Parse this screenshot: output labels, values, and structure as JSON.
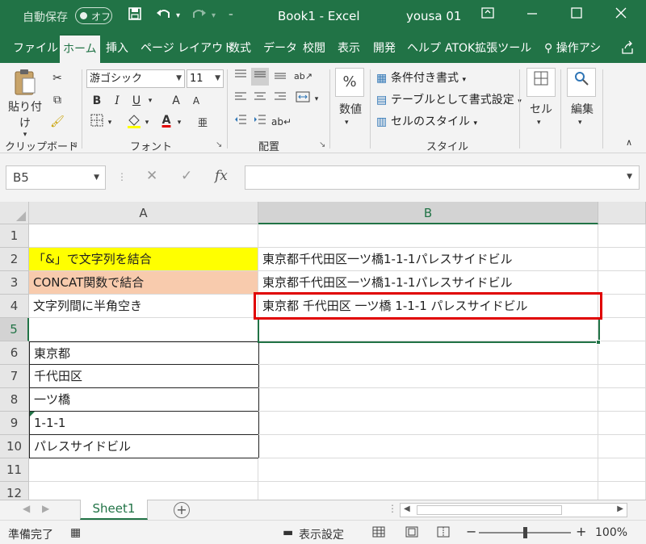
{
  "titlebar": {
    "autosave_label": "自動保存",
    "autosave_state": "オフ",
    "save_icon": "save-icon",
    "undo_icon": "undo-icon",
    "redo_icon": "redo-icon",
    "customize_icon": "customize-qat-icon",
    "doc_title": "Book1  -  Excel",
    "user": "yousa 01"
  },
  "tabs": [
    {
      "label": "ファイル"
    },
    {
      "label": "ホーム"
    },
    {
      "label": "挿入"
    },
    {
      "label": "ページ レイアウト"
    },
    {
      "label": "数式"
    },
    {
      "label": "データ"
    },
    {
      "label": "校閲"
    },
    {
      "label": "表示"
    },
    {
      "label": "開発"
    },
    {
      "label": "ヘルプ"
    },
    {
      "label": "ATOK拡張ツール"
    },
    {
      "label": "操作アシ"
    }
  ],
  "ribbon": {
    "clipboard": {
      "paste": "貼り付け",
      "label": "クリップボード"
    },
    "font": {
      "name": "游ゴシック",
      "size": "11",
      "bold": "B",
      "italic": "I",
      "underline": "U",
      "grow": "A",
      "shrink": "A",
      "font_color_letter": "A",
      "label": "フォント"
    },
    "alignment": {
      "label": "配置"
    },
    "number": {
      "pct": "%",
      "label_btn": "数値"
    },
    "styles": {
      "conditional": "条件付き書式",
      "as_table": "テーブルとして書式設定",
      "cell_styles": "セルのスタイル",
      "label": "スタイル"
    },
    "cells": {
      "label": "セル"
    },
    "editing": {
      "label": "編集"
    }
  },
  "formula_bar": {
    "name_box": "B5",
    "cancel": "✕",
    "enter": "✓",
    "fx": "fx",
    "value": ""
  },
  "columns": [
    {
      "label": "A"
    },
    {
      "label": "B"
    }
  ],
  "rows": [
    {
      "num": "1",
      "a": "",
      "b": ""
    },
    {
      "num": "2",
      "a": "「&」で文字列を結合",
      "b": "東京都千代田区一ツ橋1-1-1パレスサイドビル"
    },
    {
      "num": "3",
      "a": "CONCAT関数で結合",
      "b": "東京都千代田区一ツ橋1-1-1パレスサイドビル"
    },
    {
      "num": "4",
      "a": "文字列間に半角空き",
      "b": "東京都 千代田区 一ツ橋 1-1-1 パレスサイドビル"
    },
    {
      "num": "5",
      "a": "",
      "b": ""
    },
    {
      "num": "6",
      "a": "東京都",
      "b": ""
    },
    {
      "num": "7",
      "a": "千代田区",
      "b": ""
    },
    {
      "num": "8",
      "a": "一ツ橋",
      "b": ""
    },
    {
      "num": "9",
      "a": "1-1-1",
      "b": ""
    },
    {
      "num": "10",
      "a": "パレスサイドビル",
      "b": ""
    },
    {
      "num": "11",
      "a": "",
      "b": ""
    },
    {
      "num": "12",
      "a": "",
      "b": ""
    }
  ],
  "sheet": {
    "tab": "Sheet1",
    "add": "+"
  },
  "status": {
    "ready": "準備完了",
    "display_settings": "表示設定",
    "zoom": "100%",
    "minus": "−",
    "plus": "+"
  },
  "colors": {
    "brand": "#217346",
    "highlight_yellow": "#ffff00",
    "highlight_peach": "#f8cbad",
    "callout_red": "#e00000"
  }
}
